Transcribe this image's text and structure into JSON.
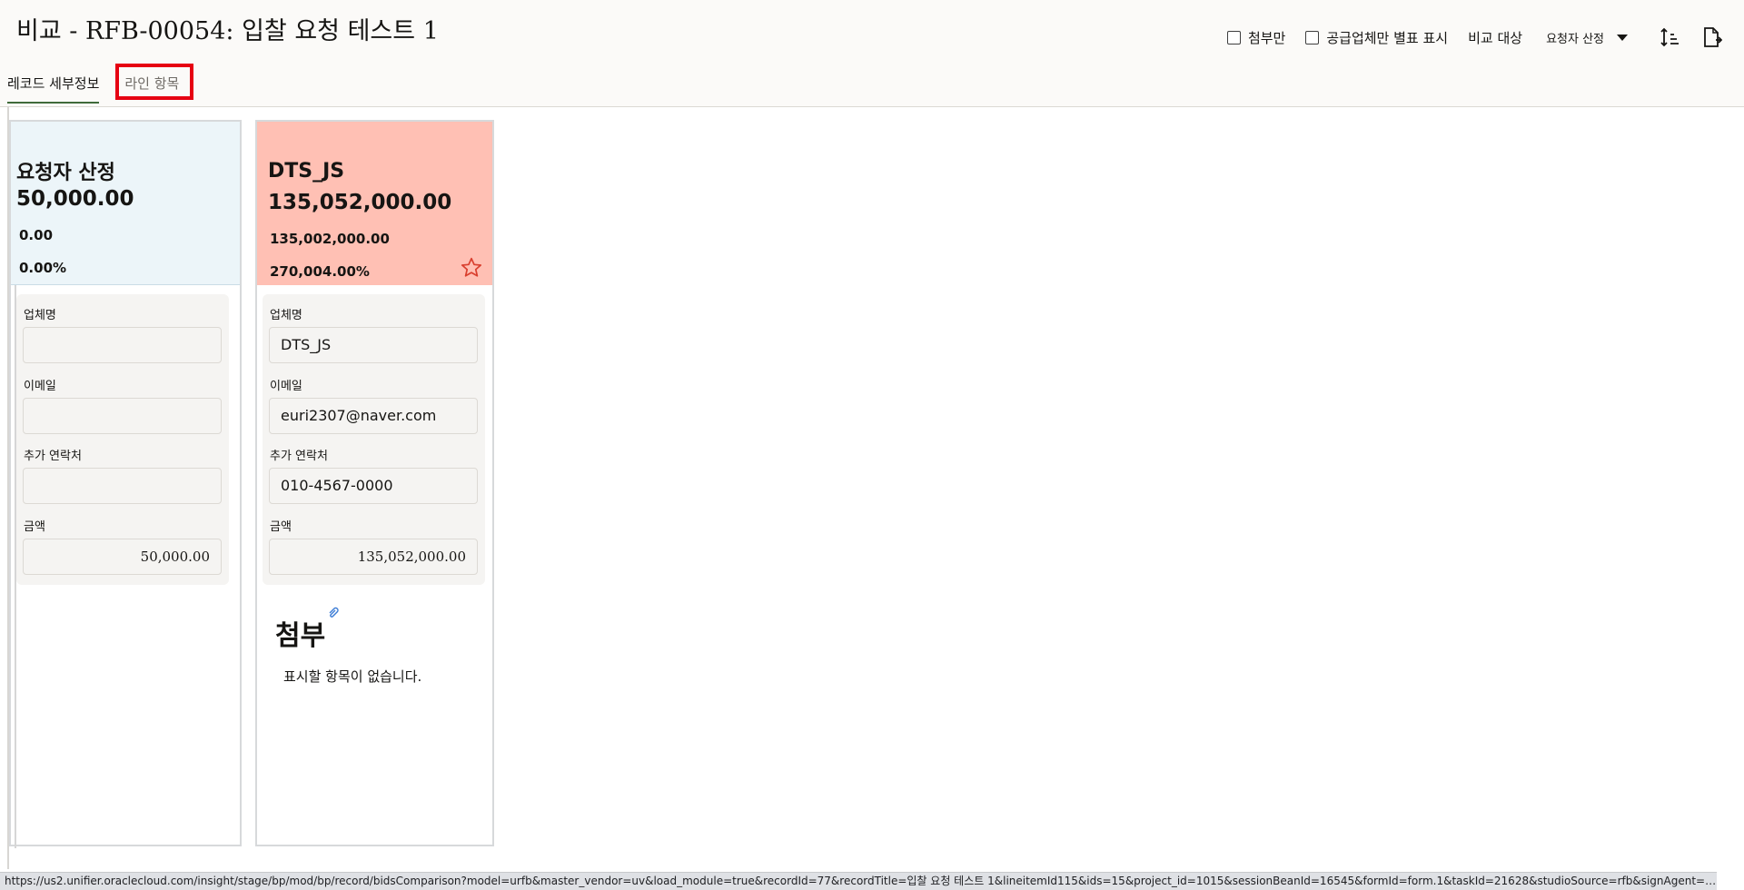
{
  "header": {
    "title": "비교 - RFB-00054: 입찰 요청 테스트 1",
    "toolbar": {
      "attachments_only_label": "첨부만",
      "per_vendor_label": "공급업체만 별표 표시",
      "compare_label": "비교 대상",
      "compare_select_value": "요청자 산정",
      "sort_icon": "sort-icon",
      "export_icon": "export-icon"
    },
    "tabs": [
      {
        "label": "레코드 세부정보",
        "active": true
      },
      {
        "label": "라인 항목",
        "active": false
      }
    ]
  },
  "columns": [
    {
      "summary": {
        "name": "요청자 산정",
        "total": "50,000.00",
        "difference": "0.00",
        "percent": "0.00%"
      },
      "fields": {
        "vendor_label": "업체명",
        "vendor_value": "",
        "email_label": "이메일",
        "email_value": "",
        "contact_label": "추가 연락처",
        "contact_value": "",
        "amount_label": "금액",
        "amount_value": "50,000.00"
      }
    },
    {
      "summary": {
        "name": "DTS_JS",
        "total": "135,052,000.00",
        "difference": "135,002,000.00",
        "percent": "270,004.00%"
      },
      "fields": {
        "vendor_label": "업체명",
        "vendor_value": "DTS_JS",
        "email_label": "이메일",
        "email_value": "euri2307@naver.com",
        "contact_label": "추가 연락처",
        "contact_value": "010-4567-0000",
        "amount_label": "금액",
        "amount_value": "135,052,000.00"
      },
      "attachments": {
        "title": "첨부",
        "empty_message": "표시할 항목이 없습니다."
      }
    }
  ],
  "status_bar": {
    "url": "https://us2.unifier.oraclecloud.com/insight/stage/bp/mod/bp/record/bidsComparison?model=urfb&master_vendor=uv&load_module=true&recordId=77&recordTitle=입찰 요청 테스트 1&lineitemId115&ids=15&project_id=1015&sessionBeanId=16545&formId=form.1&taskId=21628&studioSource=rfb&signAgent=DocuSign&isEsignEnabled=t..."
  },
  "colors": {
    "requester_bg": "#ecf5f9",
    "vendor_bg": "#ffc0b4",
    "highlight": "#e60012",
    "active_tab": "#3f6a3a"
  }
}
